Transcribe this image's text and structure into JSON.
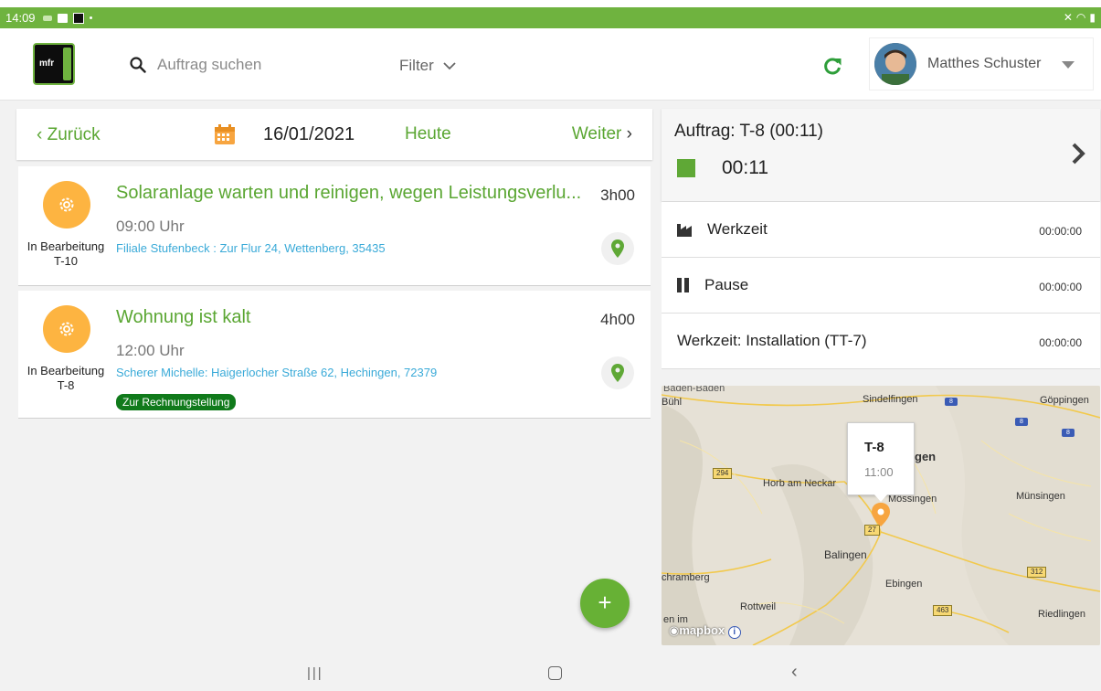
{
  "statusbar": {
    "time": "14:09"
  },
  "header": {
    "logo_text": "mfr",
    "search_placeholder": "Auftrag suchen",
    "filter_label": "Filter",
    "user_name": "Matthes Schuster"
  },
  "datenav": {
    "back_label": "Zurück",
    "date": "16/01/2021",
    "today_label": "Heute",
    "next_label": "Weiter"
  },
  "orders": [
    {
      "title": "Solaranlage warten und reinigen, wegen Leistungsverlu...",
      "duration": "3h00",
      "time": "09:00 Uhr",
      "status": "In Bearbeitung",
      "id": "T-10",
      "address": "Filiale Stufenbeck : Zur Flur 24, Wettenberg, 35435",
      "tag": ""
    },
    {
      "title": "Wohnung ist kalt",
      "duration": "4h00",
      "time": "12:00 Uhr",
      "status": "In Bearbeitung",
      "id": "T-8",
      "address": "Scherer Michelle: Haigerlocher Straße 62, Hechingen, 72379",
      "tag": "Zur Rechnungstellung"
    }
  ],
  "fab_label": "+",
  "current_order": {
    "title": "Auftrag: T-8  (00:11)",
    "timer": "00:11",
    "accent": "#5fa836"
  },
  "time_rows": [
    {
      "label": "Werkzeit",
      "value": "00:00:00",
      "icon": "factory-icon"
    },
    {
      "label": "Pause",
      "value": "00:00:00",
      "icon": "pause-icon"
    },
    {
      "label": "Werkzeit: Installation (TT-7)",
      "value": "00:00:00",
      "icon": ""
    }
  ],
  "map": {
    "popup_title": "T-8",
    "popup_time": "11:00",
    "attribution": "mapbox",
    "cities": [
      "Baden-Baden",
      "Bühl",
      "Sindelfingen",
      "Göppingen",
      "Horb am Neckar",
      "gen",
      "Mössingen",
      "Münsingen",
      "Balingen",
      "chramberg",
      "Ebingen",
      "Rottweil",
      "Riedlingen",
      "en im"
    ],
    "roads": [
      "294",
      "27",
      "312",
      "463"
    ],
    "highways": [
      "8",
      "8",
      "8"
    ]
  },
  "colors": {
    "brand_green": "#6fb33f",
    "link_blue": "#3aaad8",
    "status_orange": "#fdb441",
    "tag_green": "#107a1b"
  }
}
